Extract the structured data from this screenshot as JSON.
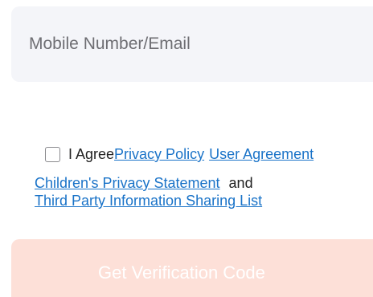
{
  "login_form": {
    "account_input": {
      "placeholder": "Mobile Number/Email",
      "value": ""
    },
    "agreement": {
      "prefix": "I Agree",
      "privacy_policy": "Privacy Policy",
      "user_agreement": "User Agreement",
      "childrens_privacy": "Children's Privacy Statement",
      "and": "and",
      "third_party_list": "Third Party Information Sharing List",
      "checked": false
    },
    "submit_button": {
      "label": "Get Verification Code",
      "state": "disabled"
    }
  },
  "colors": {
    "input_background": "#f4f5f9",
    "link": "#1a73c8",
    "button_disabled": "#fde0d8",
    "button_text": "#ffffff"
  }
}
